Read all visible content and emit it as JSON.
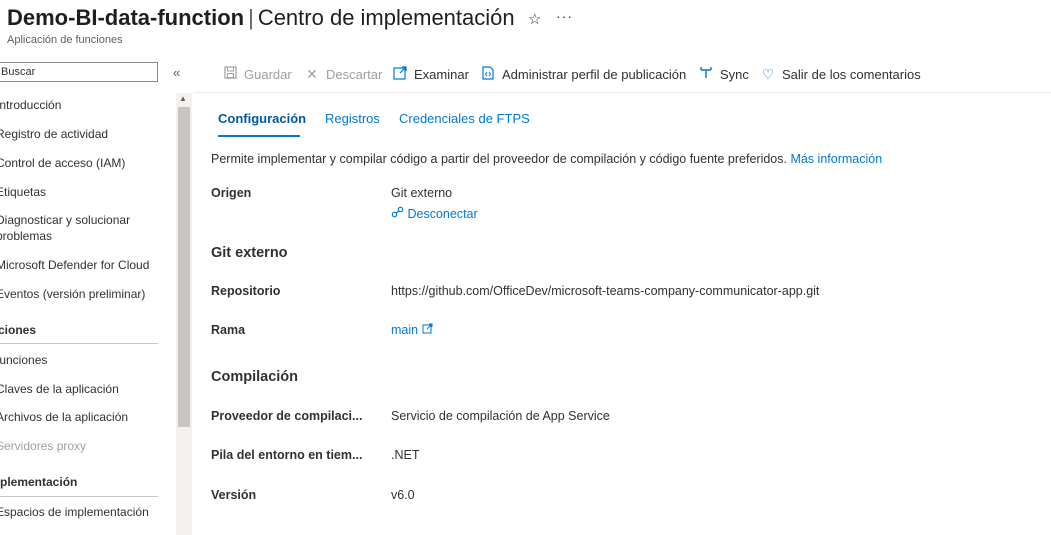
{
  "header": {
    "resource_name": "Demo-BI-data-function",
    "separator": "|",
    "page_name": "Centro de implementación",
    "subtitle": "Aplicación de funciones",
    "star_icon": "☆",
    "more_icon": "···"
  },
  "sidebar": {
    "search_placeholder": "Buscar",
    "collapse_icon": "«",
    "items": [
      {
        "label": "Introducción"
      },
      {
        "label": "Registro de actividad"
      },
      {
        "label": "Control de acceso (IAM)"
      },
      {
        "label": "Etiquetas"
      },
      {
        "label": "Diagnosticar y solucionar"
      },
      {
        "label": "problemas"
      },
      {
        "label": "Microsoft Defender for Cloud"
      },
      {
        "label": "Eventos (versión preliminar)"
      },
      {
        "label": "Funciones"
      },
      {
        "label": "Funciones"
      },
      {
        "label": "Claves de la aplicación"
      },
      {
        "label": "Archivos de la aplicación"
      },
      {
        "label": "Servidores proxy"
      },
      {
        "label": "Implementación"
      },
      {
        "label": "Espacios de implementación"
      }
    ]
  },
  "toolbar": {
    "save": "Guardar",
    "discard": "Descartar",
    "browse": "Examinar",
    "manage_profile": "Administrar perfil de publicación",
    "sync": "Sync",
    "feedback": "Salir de los comentarios"
  },
  "tabs": [
    "Configuración",
    "Registros",
    "Credenciales de FTPS"
  ],
  "content": {
    "description": "Permite implementar y compilar código a partir del proveedor de compilación y código fuente preferidos.",
    "more_info": "Más información",
    "source_label": "Origen",
    "source_value": "Git externo",
    "disconnect": "Desconectar",
    "git_section": "Git externo",
    "repo_label": "Repositorio",
    "repo_value": "https://github.com/OfficeDev/microsoft-teams-company-communicator-app.git",
    "branch_label": "Rama",
    "branch_value": "main",
    "build_section": "Compilación",
    "provider_label": "Proveedor de compilaci...",
    "provider_value": "Servicio de compilación de App Service",
    "stack_label": "Pila del entorno en tiem...",
    "stack_value": ".NET",
    "version_label": "Versión",
    "version_value": "v6.0"
  },
  "colors": {
    "accent": "#0078d4",
    "disabled": "#a19f9d",
    "text": "#323130"
  }
}
